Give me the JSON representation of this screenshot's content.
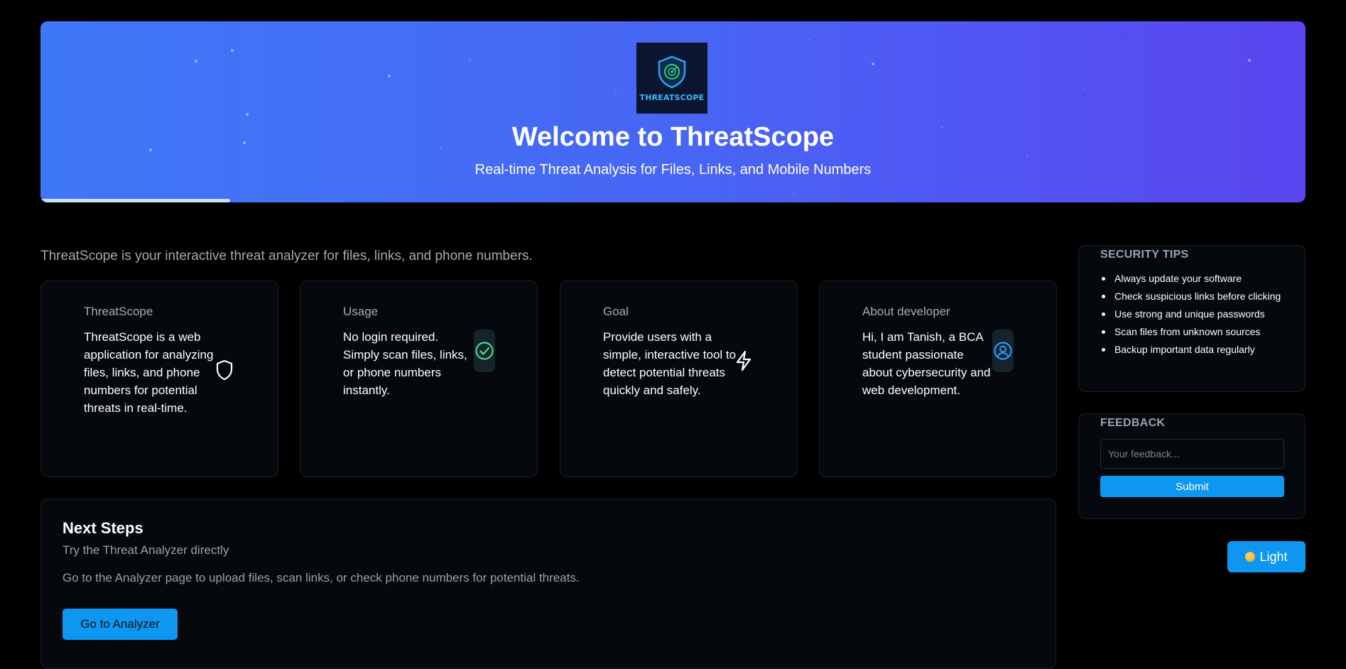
{
  "hero": {
    "logo_text": "THREATSCOPE",
    "title": "Welcome to ThreatScope",
    "subtitle": "Real-time Threat Analysis for Files, Links, and Mobile Numbers",
    "progress": 0.15
  },
  "intro": "ThreatScope is your interactive threat analyzer for files, links, and phone numbers.",
  "cards": [
    {
      "title": "ThreatScope",
      "body": "ThreatScope is a web application for analyzing files, links, and phone numbers for potential threats in real-time.",
      "icon": "shield-icon"
    },
    {
      "title": "Usage",
      "body": "No login required. Simply scan files, links, or phone numbers instantly.",
      "icon": "check-circle-icon"
    },
    {
      "title": "Goal",
      "body": "Provide users with a simple, interactive tool to detect potential threats quickly and safely.",
      "icon": "lightning-icon"
    },
    {
      "title": "About developer",
      "body": "Hi, I am Tanish, a BCA student passionate about cybersecurity and web development.",
      "icon": "user-circle-icon"
    }
  ],
  "next_steps": {
    "title": "Next Steps",
    "subtitle": "Try the Threat Analyzer directly",
    "description": "Go to the Analyzer page to upload files, scan links, or check phone numbers for potential threats.",
    "button_label": "Go to Analyzer"
  },
  "security_tips": {
    "title": "SECURITY TIPS",
    "items": [
      "Always update your software",
      "Check suspicious links before clicking",
      "Use strong and unique passwords",
      "Scan files from unknown sources",
      "Backup important data regularly"
    ]
  },
  "feedback": {
    "title": "FEEDBACK",
    "placeholder": "Your feedback...",
    "submit_label": "Submit"
  },
  "theme_toggle": {
    "label": "Light",
    "icon": "sun-icon"
  },
  "colors": {
    "accent": "#0d97f0",
    "hero_gradient_start": "#3f78f6",
    "hero_gradient_end": "#5a45f0",
    "background": "#000000",
    "card_background": "#05080d"
  }
}
